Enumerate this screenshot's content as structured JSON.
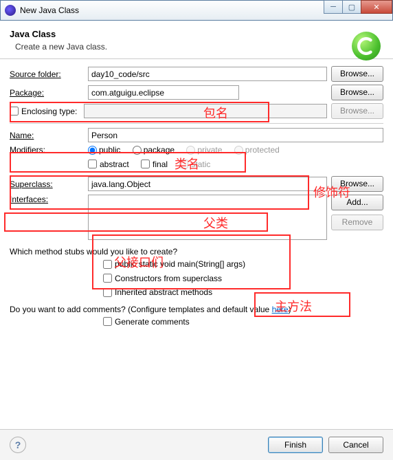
{
  "window": {
    "title": "New Java Class"
  },
  "header": {
    "title": "Java Class",
    "subtitle": "Create a new Java class."
  },
  "labels": {
    "source_folder": "Source folder:",
    "package": "Package:",
    "enclosing": "Enclosing type:",
    "name": "Name:",
    "modifiers": "Modifiers:",
    "superclass": "Superclass:",
    "interfaces": "Interfaces:",
    "stubs_q": "Which method stubs would you like to create?",
    "comments_q": "Do you want to add comments? (Configure templates and default value ",
    "here": "here",
    "close_paren": ")"
  },
  "values": {
    "source_folder": "day10_code/src",
    "package": "com.atguigu.eclipse",
    "enclosing": "",
    "name": "Person",
    "superclass": "java.lang.Object"
  },
  "modifiers": {
    "public": "public",
    "package": "package",
    "private": "private",
    "protected": "protected",
    "abstract": "abstract",
    "final": "final",
    "static": "static"
  },
  "stubs": {
    "main": "public static void main(String[] args)",
    "constructors": "Constructors from superclass",
    "inherited": "Inherited abstract methods"
  },
  "comments": {
    "generate": "Generate comments"
  },
  "buttons": {
    "browse": "Browse...",
    "add": "Add...",
    "remove": "Remove",
    "finish": "Finish",
    "cancel": "Cancel"
  },
  "annotations": {
    "package": "包名",
    "name": "类名",
    "modifiers": "修饰符",
    "superclass": "父类",
    "interfaces": "父接口们",
    "main": "主方法"
  }
}
